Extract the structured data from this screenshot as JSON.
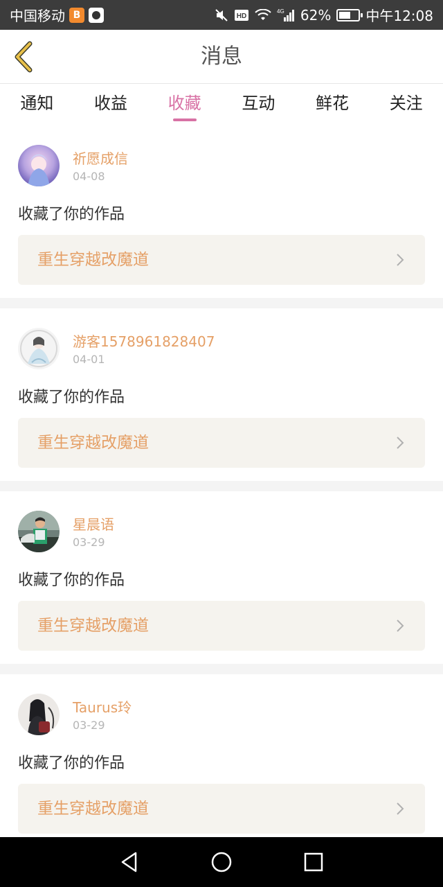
{
  "status_bar": {
    "carrier": "中国移动",
    "app_icon_1": "B",
    "network": "4G",
    "battery_percent": "62%",
    "battery_level": 0.62,
    "time": "中午12:08"
  },
  "header": {
    "title": "消息",
    "back_icon": "chevron-left-icon"
  },
  "tabs": [
    {
      "label": "通知",
      "active": false
    },
    {
      "label": "收益",
      "active": false
    },
    {
      "label": "收藏",
      "active": true
    },
    {
      "label": "互动",
      "active": false
    },
    {
      "label": "鲜花",
      "active": false
    },
    {
      "label": "关注",
      "active": false
    }
  ],
  "messages": [
    {
      "username": "祈愿成信",
      "date": "04-08",
      "text": "收藏了你的作品",
      "work_title": "重生穿越改魔道"
    },
    {
      "username": "游客1578961828407",
      "date": "04-01",
      "text": "收藏了你的作品",
      "work_title": "重生穿越改魔道"
    },
    {
      "username": "星晨语",
      "date": "03-29",
      "text": "收藏了你的作品",
      "work_title": "重生穿越改魔道"
    },
    {
      "username": "Taurus玲",
      "date": "03-29",
      "text": "收藏了你的作品",
      "work_title": "重生穿越改魔道"
    }
  ],
  "colors": {
    "accent_pink": "#d872a5",
    "username_orange": "#e5a067",
    "back_arrow": "#e8c04a",
    "link_bg": "#f5f3ee"
  }
}
